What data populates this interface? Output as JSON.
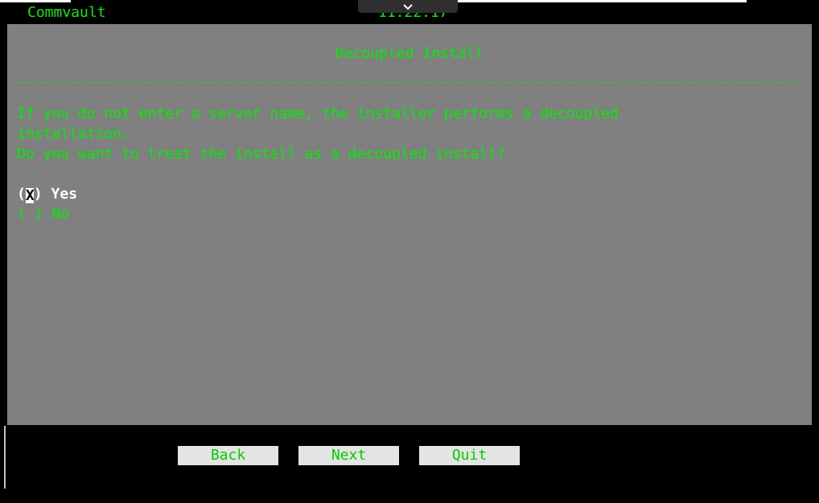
{
  "header": {
    "brand": "Commvault",
    "clock": "11:22:17"
  },
  "dialog": {
    "title": "Decoupled Install",
    "message_lines": [
      "If you do not enter a server name, the installer performs a decoupled",
      "installation.",
      "Do you want to treat the install as a decoupled install?"
    ],
    "options": [
      {
        "label": "Yes",
        "selected": true,
        "marker": "X"
      },
      {
        "label": "No",
        "selected": false,
        "marker": " "
      }
    ]
  },
  "buttons": {
    "back": "Back",
    "next": "Next",
    "quit": "Quit"
  },
  "colors": {
    "terminal_green": "#00ee00",
    "panel_gray": "#808080",
    "background": "#000000",
    "button_bg": "#e4e4e4"
  },
  "icons": {
    "pulldown": "chevron-down-icon"
  }
}
